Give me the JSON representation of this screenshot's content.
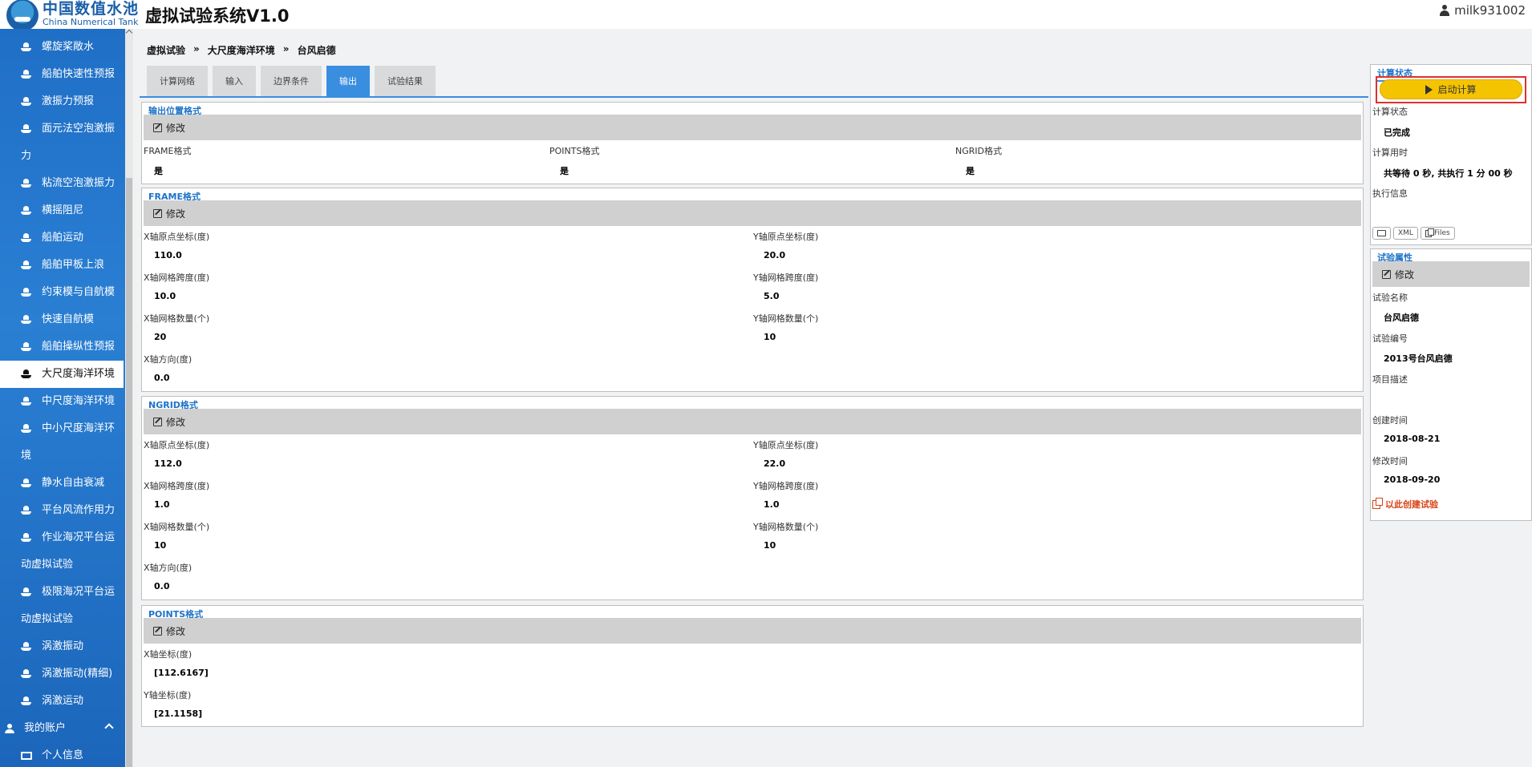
{
  "header": {
    "logo_cn": "中国数值水池",
    "logo_en": "China Numerical Tank",
    "app_title": "虚拟试验系统V1.0",
    "username": "milk931002"
  },
  "sidebar": {
    "items": [
      {
        "label": "螺旋桨敞水"
      },
      {
        "label": "船舶快速性预报"
      },
      {
        "label": "激振力预报"
      },
      {
        "label": "面元法空泡激振力",
        "line1": "面元法空泡激振",
        "line2": "力"
      },
      {
        "label": "粘流空泡激振力"
      },
      {
        "label": "横摇阻尼"
      },
      {
        "label": "船舶运动"
      },
      {
        "label": "船舶甲板上浪"
      },
      {
        "label": "约束模与自航模"
      },
      {
        "label": "快速自航模"
      },
      {
        "label": "船舶操纵性预报"
      },
      {
        "label": "大尺度海洋环境",
        "active": true
      },
      {
        "label": "中尺度海洋环境"
      },
      {
        "line1": "中小尺度海洋环",
        "line2": "境"
      },
      {
        "label": "静水自由衰减"
      },
      {
        "label": "平台风流作用力"
      },
      {
        "line1": "作业海况平台运",
        "line2": "动虚拟试验"
      },
      {
        "line1": "极限海况平台运",
        "line2": "动虚拟试验"
      },
      {
        "label": "涡激振动"
      },
      {
        "label": "涡激振动(精细)"
      },
      {
        "label": "涡激运动"
      }
    ],
    "account_section": "我的账户",
    "account_items": [
      {
        "label": "个人信息"
      }
    ]
  },
  "breadcrumb": [
    "虚拟试验",
    "大尺度海洋环境",
    "台风启德"
  ],
  "breadcrumb_sep": "»",
  "tabs": [
    {
      "label": "计算网络"
    },
    {
      "label": "输入"
    },
    {
      "label": "边界条件"
    },
    {
      "label": "输出",
      "active": true
    },
    {
      "label": "试验结果"
    }
  ],
  "edit_label": "修改",
  "output_format": {
    "title": "输出位置格式",
    "fields": [
      {
        "label": "FRAME格式",
        "value": "是"
      },
      {
        "label": "POINTS格式",
        "value": "是"
      },
      {
        "label": "NGRID格式",
        "value": "是"
      }
    ]
  },
  "frame": {
    "title": "FRAME格式",
    "x_origin_label": "X轴原点坐标(度)",
    "x_origin": "110.0",
    "y_origin_label": "Y轴原点坐标(度)",
    "y_origin": "20.0",
    "x_span_label": "X轴网格跨度(度)",
    "x_span": "10.0",
    "y_span_label": "Y轴网格跨度(度)",
    "y_span": "5.0",
    "x_count_label": "X轴网格数量(个)",
    "x_count": "20",
    "y_count_label": "Y轴网格数量(个)",
    "y_count": "10",
    "x_dir_label": "X轴方向(度)",
    "x_dir": "0.0"
  },
  "ngrid": {
    "title": "NGRID格式",
    "x_origin_label": "X轴原点坐标(度)",
    "x_origin": "112.0",
    "y_origin_label": "Y轴原点坐标(度)",
    "y_origin": "22.0",
    "x_span_label": "X轴网格跨度(度)",
    "x_span": "1.0",
    "y_span_label": "Y轴网格跨度(度)",
    "y_span": "1.0",
    "x_count_label": "X轴网格数量(个)",
    "x_count": "10",
    "y_count_label": "Y轴网格数量(个)",
    "y_count": "10",
    "x_dir_label": "X轴方向(度)",
    "x_dir": "0.0"
  },
  "points": {
    "title": "POINTS格式",
    "x_label": "X轴坐标(度)",
    "x_value": "[112.6167]",
    "y_label": "Y轴坐标(度)",
    "y_value": "[21.1158]"
  },
  "calc_status": {
    "title": "计算状态",
    "start_button": "启动计算",
    "status_label": "计算状态",
    "status_value": "已完成",
    "time_label": "计算用时",
    "time_value": "共等待 0 秒, 共执行 1 分 00 秒",
    "exec_label": "执行信息",
    "btn_xml": "XML",
    "btn_files": "Files"
  },
  "experiment": {
    "title": "试验属性",
    "name_label": "试验名称",
    "name_value": "台风启德",
    "id_label": "试验编号",
    "id_value": "2013号台风启德",
    "desc_label": "项目描述",
    "desc_value": "",
    "created_label": "创建时间",
    "created_value": "2018-08-21",
    "modified_label": "修改时间",
    "modified_value": "2018-09-20",
    "create_link": "以此创建试验"
  },
  "colors": {
    "accent": "#3a8ee0",
    "sidebar": "#2a7fd3",
    "start_button": "#f5c400",
    "highlight_border": "#e03030",
    "link_warning": "#d84315"
  }
}
